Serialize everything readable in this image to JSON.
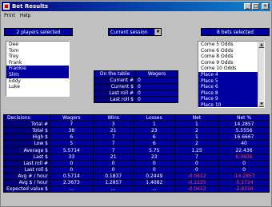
{
  "window": {
    "title": "Bet Results"
  },
  "menu": [
    "Print",
    "Help"
  ],
  "players_header": "2 players selected",
  "session": {
    "value": "Current session"
  },
  "bets_header": "8 bets selected",
  "players": [
    {
      "label": "Dee",
      "selected": false
    },
    {
      "label": "Tom",
      "selected": false
    },
    {
      "label": "Trey",
      "selected": false
    },
    {
      "label": "Frank",
      "selected": false
    },
    {
      "label": "Frankie",
      "selected": true
    },
    {
      "label": "Slim",
      "selected": true
    },
    {
      "label": "Eddy",
      "selected": false
    },
    {
      "label": "Luke",
      "selected": false
    }
  ],
  "bets": [
    {
      "label": "Come 5 Odds",
      "selected": false
    },
    {
      "label": "Come 6 Odds",
      "selected": false
    },
    {
      "label": "Come 8 Odds",
      "selected": false
    },
    {
      "label": "Come 9 Odds",
      "selected": false
    },
    {
      "label": "Come 10 Odds",
      "selected": false
    },
    {
      "label": "Place 4",
      "selected": true
    },
    {
      "label": "Place 5",
      "selected": true
    },
    {
      "label": "Place 6",
      "selected": true
    },
    {
      "label": "Place 8",
      "selected": true
    },
    {
      "label": "Place 9",
      "selected": true
    },
    {
      "label": "Place 10",
      "selected": true
    }
  ],
  "on_table": {
    "headers": [
      "On the table",
      "Wagers"
    ],
    "rows": [
      {
        "label": "Current #",
        "value": "0"
      },
      {
        "label": "Current $",
        "value": "0"
      },
      {
        "label": "Last roll #",
        "value": "0"
      },
      {
        "label": "Last roll $",
        "value": "0"
      }
    ]
  },
  "results": {
    "headers": [
      "Decisions",
      "Wagers",
      "Wins",
      "Losses",
      "Net",
      "Net %"
    ],
    "rows": [
      {
        "label": "Total #",
        "cells": [
          "7",
          "3",
          "1",
          "1",
          "14.2857"
        ],
        "neg": [
          false,
          false,
          false,
          false,
          false
        ]
      },
      {
        "label": "Total $",
        "cells": [
          "36",
          "21",
          "23",
          "2",
          "5.5556"
        ],
        "neg": [
          false,
          false,
          false,
          false,
          false
        ]
      },
      {
        "label": "High $",
        "cells": [
          "6",
          "7",
          "6",
          "1",
          "16.6667"
        ],
        "neg": [
          false,
          false,
          false,
          false,
          false
        ]
      },
      {
        "label": "Low $",
        "cells": [
          "5",
          "7",
          "6",
          "2",
          "40"
        ],
        "neg": [
          false,
          false,
          false,
          false,
          false
        ]
      },
      {
        "label": "Average $",
        "cells": [
          "5.5714",
          "7",
          "5.75",
          "1.25",
          "22.436"
        ],
        "neg": [
          false,
          false,
          false,
          false,
          false
        ]
      },
      {
        "label": "Last $",
        "cells": [
          "33",
          "21",
          "23",
          "7",
          "6.0606"
        ],
        "neg": [
          false,
          false,
          false,
          false,
          true
        ]
      },
      {
        "label": "Last roll #",
        "cells": [
          "0",
          "0",
          "0",
          "0",
          "0"
        ],
        "neg": [
          false,
          false,
          false,
          false,
          false
        ]
      },
      {
        "label": "Last roll $",
        "cells": [
          "0",
          "0",
          "0",
          "0",
          "0"
        ],
        "neg": [
          false,
          false,
          false,
          false,
          false
        ]
      },
      {
        "label": "Avg # / hour",
        "cells": [
          "0.5714",
          "0.1837",
          "0.2449",
          "-0.0612",
          "-14.2857"
        ],
        "neg": [
          false,
          false,
          false,
          true,
          true
        ]
      },
      {
        "label": "Avg $ / hour",
        "cells": [
          "2.3673",
          "1.2857",
          "1.4082",
          "-0.1225",
          "-5.1724"
        ],
        "neg": [
          false,
          false,
          false,
          true,
          true
        ]
      },
      {
        "label": "Expected value $",
        "cells": [
          "...",
          "...",
          "...",
          "-0.0612",
          "-2.6316"
        ],
        "neg": [
          false,
          false,
          false,
          true,
          true
        ]
      }
    ]
  },
  "colors": {
    "panel": "#0000a0",
    "label": "#000080",
    "negative": "#ff4040",
    "titlebar": "#000080"
  }
}
